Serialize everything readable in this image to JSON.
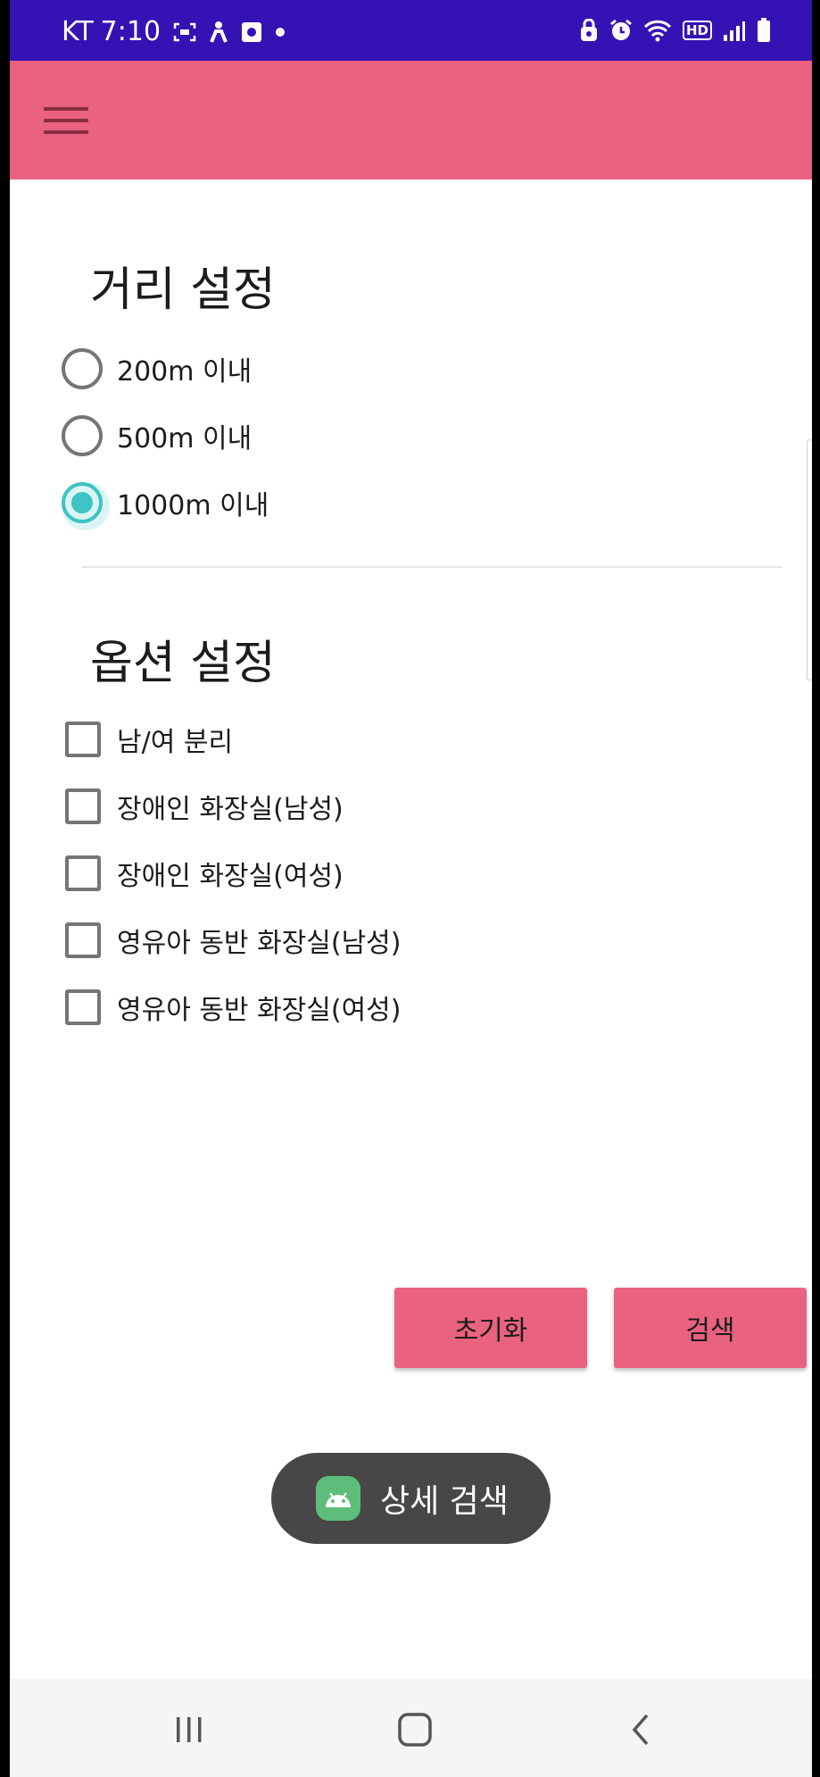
{
  "status_bar": {
    "carrier": "KT",
    "time": "7:10",
    "hd_label": "HD",
    "left_icons": [
      "screenshot-icon",
      "accessibility-icon",
      "media-icon",
      "dot-icon"
    ],
    "right_icons": [
      "lock-icon",
      "alarm-icon",
      "wifi-icon",
      "hd-icon",
      "signal-icon",
      "battery-icon"
    ],
    "color": "#3512b4"
  },
  "app_bar": {
    "menu_icon": "hamburger-menu-icon",
    "color": "#e9627f"
  },
  "distance_section": {
    "title": "거리 설정",
    "options": [
      {
        "label": "200m 이내",
        "checked": false
      },
      {
        "label": "500m 이내",
        "checked": false
      },
      {
        "label": "1000m 이내",
        "checked": true
      }
    ]
  },
  "option_section": {
    "title": "옵션 설정",
    "options": [
      {
        "label": "남/여 분리",
        "checked": false
      },
      {
        "label": "장애인 화장실(남성)",
        "checked": false
      },
      {
        "label": "장애인 화장실(여성)",
        "checked": false
      },
      {
        "label": "영유아 동반 화장실(남성)",
        "checked": false
      },
      {
        "label": "영유아 동반 화장실(여성)",
        "checked": false
      }
    ]
  },
  "actions": {
    "reset_label": "초기화",
    "search_label": "검색",
    "color": "#e9627f"
  },
  "toast": {
    "icon": "android-icon",
    "text": "상세 검색"
  },
  "nav_bar": {
    "items": [
      "recents-icon",
      "home-icon",
      "back-icon"
    ]
  },
  "accent_color": "#3ec4c4"
}
